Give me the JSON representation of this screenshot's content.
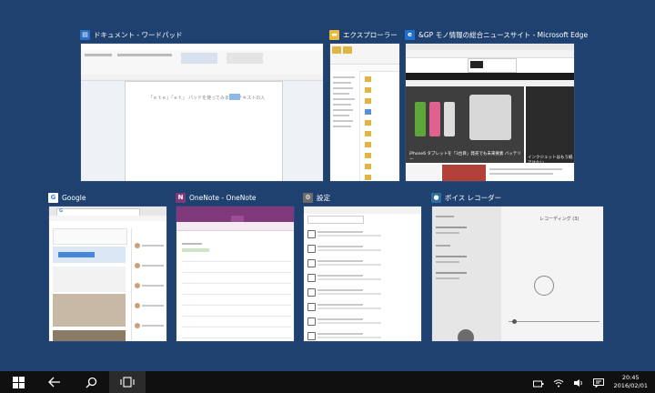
{
  "windows": [
    {
      "id": "wordpad",
      "title": "ドキュメント - ワードパッド",
      "icon": "wordpad-icon",
      "thumb_text": "「ｅｔｅ」「ｅｔ」 パッドを使ってみます。テキストの入"
    },
    {
      "id": "explorer",
      "title": "エクスプローラー",
      "icon": "folder-icon"
    },
    {
      "id": "edge",
      "title": "&GP モノ情報の総合ニュースサイト - Microsoft Edge",
      "icon": "edge-icon",
      "thumb_text": "iPhone6 タブレットを「3台目」発売でも未来要素 バッテリー",
      "thumb_text2": "インクジェットはもう紙ではない"
    },
    {
      "id": "chrome",
      "title": "Google",
      "icon": "google-icon",
      "thumb_text": "G"
    },
    {
      "id": "onenote",
      "title": "OneNote - OneNote",
      "icon": "onenote-icon"
    },
    {
      "id": "settings",
      "title": "設定",
      "icon": "gear-icon"
    },
    {
      "id": "voice",
      "title": "ボイス レコーダー",
      "icon": "microphone-icon",
      "thumb_text": "レコーディング (3)"
    }
  ],
  "taskbar": {
    "start": "windows-logo-icon",
    "back": "back-arrow-icon",
    "search": "search-icon",
    "taskview": "task-view-icon",
    "time": "20:45",
    "date": "2016/02/01"
  },
  "colors": {
    "desktop": "#1f416f",
    "taskbar": "#101010"
  }
}
